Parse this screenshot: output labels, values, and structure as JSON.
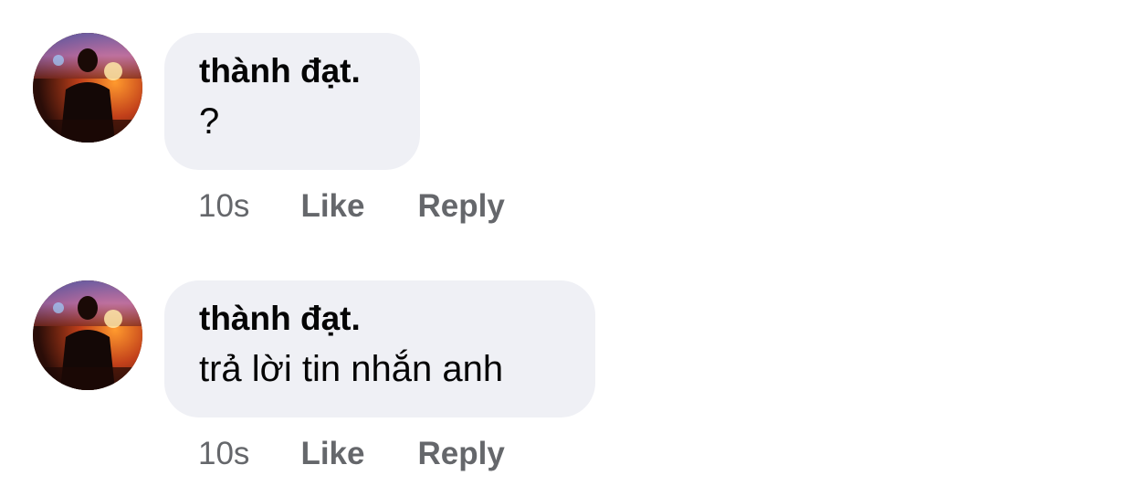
{
  "comments": [
    {
      "author": "thành đạt.",
      "text": "?",
      "time": "10s",
      "like_label": "Like",
      "reply_label": "Reply",
      "avatar_icon": "profile-photo-concert-silhouette"
    },
    {
      "author": "thành đạt.",
      "text": "trả lời tin nhắn anh",
      "time": "10s",
      "like_label": "Like",
      "reply_label": "Reply",
      "avatar_icon": "profile-photo-concert-silhouette"
    }
  ],
  "colors": {
    "bubble": "#eff0f5",
    "text": "#050505",
    "secondary": "#65676b"
  }
}
